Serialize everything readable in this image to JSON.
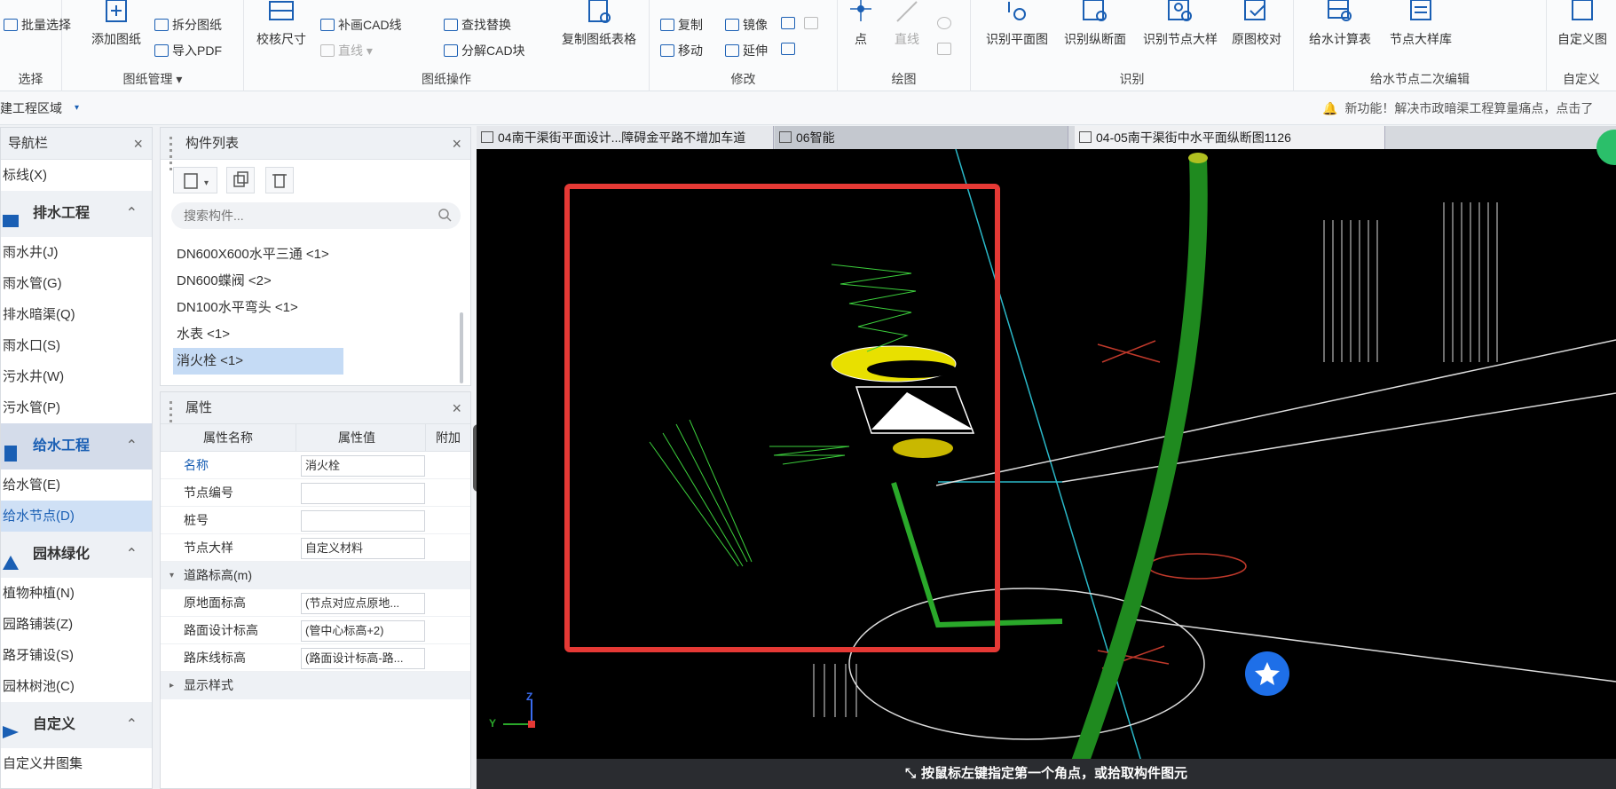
{
  "ribbon": {
    "groups": {
      "select": "选择",
      "drawing_mgmt": "图纸管理",
      "drawing_ops": "图纸操作",
      "modify": "修改",
      "draw": "绘图",
      "identify": "识别",
      "supply_node_edit": "给水节点二次编辑",
      "custom": "自定义"
    },
    "batch_select": "批量选择",
    "add_drawing": "添加图纸",
    "split_drawing": "拆分图纸",
    "import_pdf": "导入PDF",
    "check_size": "校核尺寸",
    "fill_cad_line": "补画CAD线",
    "line": "直线",
    "find_replace": "查找替换",
    "explode_cad": "分解CAD块",
    "copy_table": "复制图纸表格",
    "copy": "复制",
    "mirror": "镜像",
    "move": "移动",
    "extend": "延伸",
    "point": "点",
    "line2": "直线",
    "id_plan": "识别平面图",
    "id_profile": "识别纵断面",
    "id_node_detail": "识别节点大样",
    "orig_check": "原图校对",
    "supply_calc": "给水计算表",
    "node_lib": "节点大样库",
    "custom_btn": "自定义图"
  },
  "subbar": {
    "area": "建工程区域",
    "notice": "新功能！解决市政暗渠工程算量痛点，点击了"
  },
  "nav": {
    "title": "导航栏",
    "items_top": [
      "标线(X)"
    ],
    "groups": [
      {
        "label": "排水工程",
        "items": [
          "雨水井(J)",
          "雨水管(G)",
          "排水暗渠(Q)",
          "雨水口(S)",
          "污水井(W)",
          "污水管(P)"
        ]
      },
      {
        "label": "给水工程",
        "items": [
          "给水管(E)",
          "给水节点(D)"
        ]
      },
      {
        "label": "园林绿化",
        "items": [
          "植物种植(N)",
          "园路铺装(Z)",
          "路牙铺设(S)",
          "园林树池(C)"
        ]
      },
      {
        "label": "自定义",
        "items": [
          "自定义井图集"
        ]
      }
    ]
  },
  "components": {
    "title": "构件列表",
    "search_placeholder": "搜索构件...",
    "items": [
      "DN600X600水平三通 <1>",
      "DN600蝶阀 <2>",
      "DN100水平弯头 <1>",
      "水表 <1>",
      "消火栓 <1>"
    ]
  },
  "props": {
    "title": "属性",
    "col_name": "属性名称",
    "col_value": "属性值",
    "col_extra": "附加",
    "rows": [
      {
        "name": "名称",
        "value": "消火栓"
      },
      {
        "name": "节点编号",
        "value": ""
      },
      {
        "name": "桩号",
        "value": ""
      },
      {
        "name": "节点大样",
        "value": "自定义材料"
      }
    ],
    "section_road": "道路标高(m)",
    "road_rows": [
      {
        "name": "原地面标高",
        "value": "(节点对应点原地..."
      },
      {
        "name": "路面设计标高",
        "value": "(管中心标高+2)"
      },
      {
        "name": "路床线标高",
        "value": "(路面设计标高-路..."
      }
    ],
    "section_style": "显示样式"
  },
  "tabs": [
    "04南干渠街平面设计...障碍金平路不增加车道",
    "06智能",
    "04-05南干渠街中水平面纵断图1126"
  ],
  "status": "按鼠标左键指定第一个角点，或拾取构件图元",
  "axis": {
    "z": "Z",
    "y": "Y"
  },
  "colors": {
    "accent": "#1a5fb4",
    "selection_box": "#e53935",
    "pipe": "#1f8a1f"
  }
}
